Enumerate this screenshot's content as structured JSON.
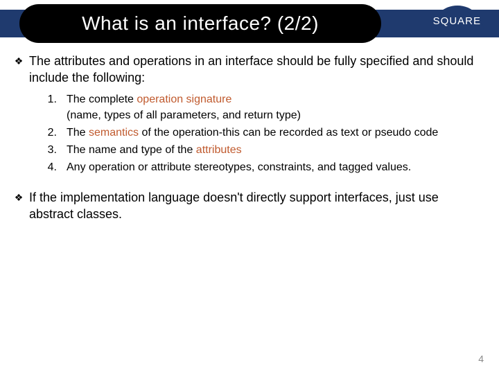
{
  "header": {
    "title": "What is an interface? (2/2)",
    "logo_text": "SQUARE"
  },
  "bullets": [
    {
      "text_a": "The attributes and operations in an interface should be fully specified and should include the following:"
    },
    {
      "text_a": "If the implementation language doesn't directly support interfaces, just use abstract classes."
    }
  ],
  "ordered": [
    {
      "num": "1.",
      "pre": "The complete ",
      "hl": "operation signature",
      "post_a": "",
      "line2": "(name, types of all parameters, and return type)"
    },
    {
      "num": "2.",
      "pre": "The ",
      "hl": "semantics",
      "post_a": " of the operation-this can be recorded as text or pseudo code",
      "line2": ""
    },
    {
      "num": "3.",
      "pre": "The name and type of the ",
      "hl": "attributes",
      "post_a": "",
      "line2": ""
    },
    {
      "num": "4.",
      "pre": "Any operation or attribute stereotypes, constraints, and tagged values.",
      "hl": "",
      "post_a": "",
      "line2": ""
    }
  ],
  "page_number": "4"
}
